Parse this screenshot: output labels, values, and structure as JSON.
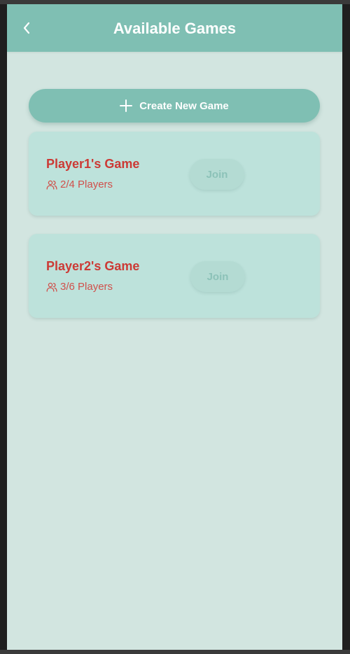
{
  "header": {
    "title": "Available Games",
    "back_icon": "chevron-left-icon"
  },
  "create_button": {
    "label": "Create New Game",
    "icon": "plus-icon"
  },
  "games": [
    {
      "title": "Player1's Game",
      "players": "2/4 Players",
      "join_label": "Join"
    },
    {
      "title": "Player2's Game",
      "players": "3/6 Players",
      "join_label": "Join"
    }
  ],
  "colors": {
    "primary": "#7fbfb3",
    "background": "#d2e5e0",
    "card": "#bde2db",
    "accent_red": "#cc3a35"
  }
}
